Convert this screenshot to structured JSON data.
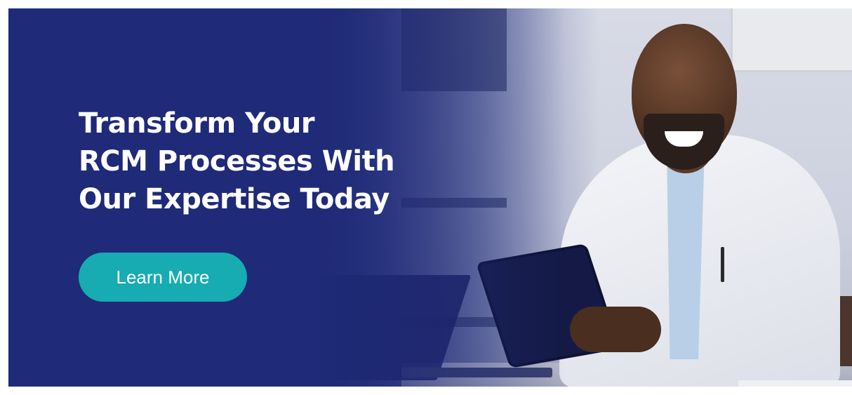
{
  "banner": {
    "headline_lines": [
      "Transform Your",
      "RCM Processes With",
      "Our Expertise Today"
    ],
    "cta_label": "Learn More"
  },
  "colors": {
    "navy_background": "#1f2a78",
    "cta_teal": "#16acb1",
    "text": "#ffffff"
  }
}
